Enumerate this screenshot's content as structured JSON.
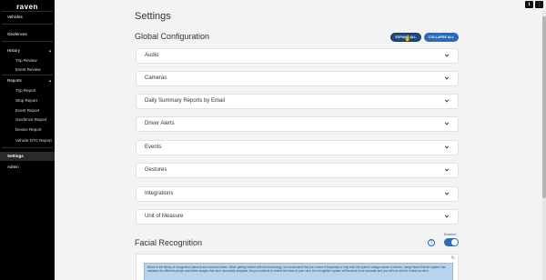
{
  "sidebar": {
    "logo": "raven",
    "items": [
      {
        "label": "Vehicles"
      },
      {
        "label": "Geofences"
      },
      {
        "label": "History"
      },
      {
        "label": "Trip Review"
      },
      {
        "label": "Event Review"
      },
      {
        "label": "Reports"
      },
      {
        "label": "Trip Report"
      },
      {
        "label": "Stop Report"
      },
      {
        "label": "Event Report"
      },
      {
        "label": "Geofence Report"
      },
      {
        "label": "Device Report"
      },
      {
        "label": "Vehicle DTC Report"
      },
      {
        "label": "Settings"
      },
      {
        "label": "Admin"
      }
    ]
  },
  "topbar": {
    "icons": [
      "info-icon",
      "more-icon"
    ]
  },
  "page": {
    "title": "Settings",
    "global_config_title": "Global Configuration",
    "expand_all": "EXPAND ALL",
    "collapse_all": "COLLAPSE ALL",
    "sections": [
      {
        "label": "Audio"
      },
      {
        "label": "Cameras"
      },
      {
        "label": "Daily Summary Reports by Email"
      },
      {
        "label": "Driver Alerts"
      },
      {
        "label": "Events"
      },
      {
        "label": "Gestures"
      },
      {
        "label": "Integrations"
      },
      {
        "label": "Unit of Measure"
      }
    ],
    "facial": {
      "title": "Facial Recognition",
      "enabled_label": "Enabled",
      "enabled": true,
      "info_text": "Below is the library of recognized (named) and unknown faces. When getting started with this technology, we recommend that you review it frequently to help train the system: assign names to drivers, merge faces that the system has mistaken for different people and delete images that were incorrectly assigned. As you continue to review the faces in your view, the recognition system will become more accurate and you will not need to review as often."
    }
  },
  "colors": {
    "accent": "#2d6ab2",
    "sidebar": "#000000",
    "background": "#f3f3f3",
    "info_box": "#b7d3ee"
  }
}
